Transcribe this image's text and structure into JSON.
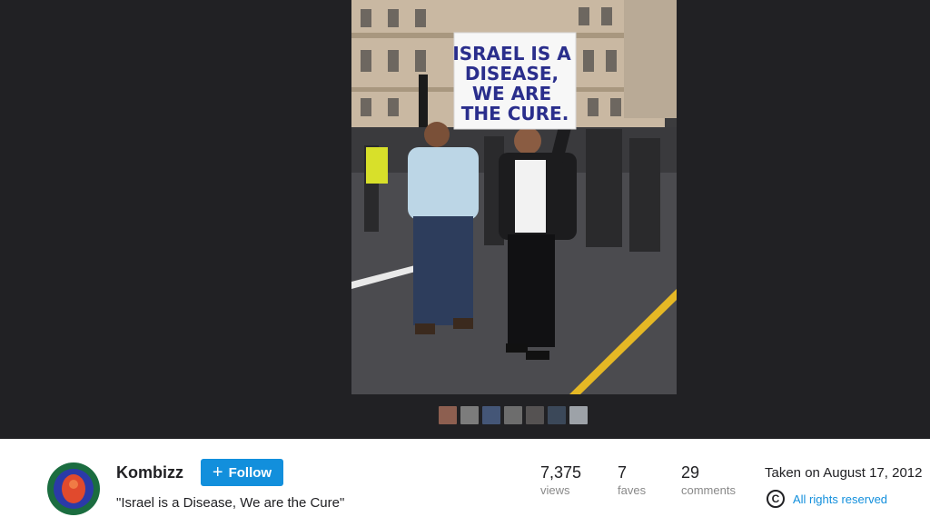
{
  "photo": {
    "sign_lines": [
      "ISRAEL IS A",
      "DISEASE,",
      "WE ARE",
      "THE CURE."
    ]
  },
  "filmstrip": {
    "thumb_colors": [
      "#a06a58",
      "#8c8c8c",
      "#4a5f86",
      "#7a7a7a",
      "#5e5b5a",
      "#3f4f63",
      "#b3b9bf"
    ]
  },
  "owner": {
    "name": "Kombizz",
    "follow_label": "Follow"
  },
  "photo_title": "\"Israel is a Disease, We are the Cure\"",
  "stats": {
    "views": {
      "value": "7,375",
      "label": "views"
    },
    "faves": {
      "value": "7",
      "label": "faves"
    },
    "comments": {
      "value": "29",
      "label": "comments"
    }
  },
  "taken": "Taken on August 17, 2012",
  "rights": {
    "icon": "copyright-icon",
    "label": "All rights reserved"
  },
  "colors": {
    "accent": "#128fdc",
    "stage_bg": "#212124"
  }
}
